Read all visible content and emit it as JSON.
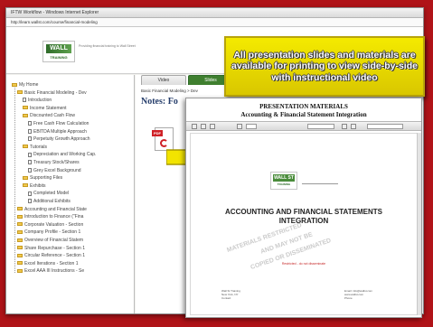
{
  "window": {
    "title": "IFTW Workflow - Windows Internet Explorer",
    "address": "http://learn.wallst.com/course/financial-modeling"
  },
  "header": {
    "logo_main": "WALL ST",
    "logo_sub": "TRAINING",
    "tagline": "Providing financial training to Wall Street"
  },
  "sidebar": {
    "items": [
      {
        "label": "My Home",
        "icon": "folder-icon",
        "indent": 0
      },
      {
        "label": "Basic Financial Modeling - Dev",
        "icon": "folder-icon",
        "indent": 1
      },
      {
        "label": "Introduction",
        "icon": "page-icon",
        "indent": 2
      },
      {
        "label": "Income Statement",
        "icon": "folder-icon",
        "indent": 2
      },
      {
        "label": "Discounted Cash Flow",
        "icon": "folder-icon",
        "indent": 2
      },
      {
        "label": "Free Cash Flow Calculation",
        "icon": "page-icon",
        "indent": 3
      },
      {
        "label": "EBITDA Multiple Approach",
        "icon": "page-icon",
        "indent": 3
      },
      {
        "label": "Perpetuity Growth Approach",
        "icon": "page-icon",
        "indent": 3
      },
      {
        "label": "Tutorials",
        "icon": "folder-icon",
        "indent": 2
      },
      {
        "label": "Depreciation and Working Cap.",
        "icon": "page-icon",
        "indent": 3
      },
      {
        "label": "Treasury Stock/Shares",
        "icon": "page-icon",
        "indent": 3
      },
      {
        "label": "Grey Excel Background",
        "icon": "page-icon",
        "indent": 3
      },
      {
        "label": "Supporting Files",
        "icon": "folder-icon",
        "indent": 2
      },
      {
        "label": "Exhibits",
        "icon": "folder-icon",
        "indent": 2
      },
      {
        "label": "Completed Model",
        "icon": "page-icon",
        "indent": 3
      },
      {
        "label": "Additional Exhibits",
        "icon": "page-icon",
        "indent": 3
      },
      {
        "label": "Accounting and Financial State",
        "icon": "folder-icon",
        "indent": 1
      },
      {
        "label": "Introduction to Finance (\"Fina",
        "icon": "folder-icon",
        "indent": 1
      },
      {
        "label": "Corporate Valuation - Section",
        "icon": "folder-icon",
        "indent": 1
      },
      {
        "label": "Company Profile - Section 1",
        "icon": "folder-icon",
        "indent": 1
      },
      {
        "label": "Overview of Financial Statem",
        "icon": "folder-icon",
        "indent": 1
      },
      {
        "label": "Share Repurchase - Section 1",
        "icon": "folder-icon",
        "indent": 1
      },
      {
        "label": "Circular Reference - Section 1",
        "icon": "folder-icon",
        "indent": 1
      },
      {
        "label": "Excel Iterations - Section 1",
        "icon": "folder-icon",
        "indent": 1
      },
      {
        "label": "Excel AAA III Instructions - Se",
        "icon": "folder-icon",
        "indent": 1
      }
    ]
  },
  "main": {
    "tabs": [
      {
        "label": "Video"
      },
      {
        "label": "Slides"
      }
    ],
    "breadcrumb": "Basic Financial Modeling > Dev",
    "notes_title": "Notes: Fo",
    "pdf_badge": "PDF"
  },
  "banner": {
    "text": "All presentation slides and materials are available for printing to view side-by-side with instructional video"
  },
  "pdf": {
    "heading1": "PRESENTATION MATERIALS",
    "heading2": "Accounting & Financial Statement Integration",
    "page": {
      "logo_main": "WALL ST",
      "logo_sub": "TRAINING",
      "title_line1": "ACCOUNTING AND FINANCIAL STATEMENTS",
      "title_line2": "INTEGRATION",
      "watermark": [
        "MATERIALS RESTRICTED",
        "AND MAY NOT BE",
        "COPIED OR DISSEMINATED"
      ],
      "red_note": "Restricted - do not disseminate",
      "footer_left": [
        "Wall St Training",
        "New York, NY",
        "Contact"
      ],
      "footer_right": [
        "Email: info@wallst.com",
        "www.wallst.com",
        "Phone"
      ]
    }
  },
  "colors": {
    "background": "#b01318",
    "banner": "#f4ea00",
    "brand_green": "#3f7f2f"
  }
}
